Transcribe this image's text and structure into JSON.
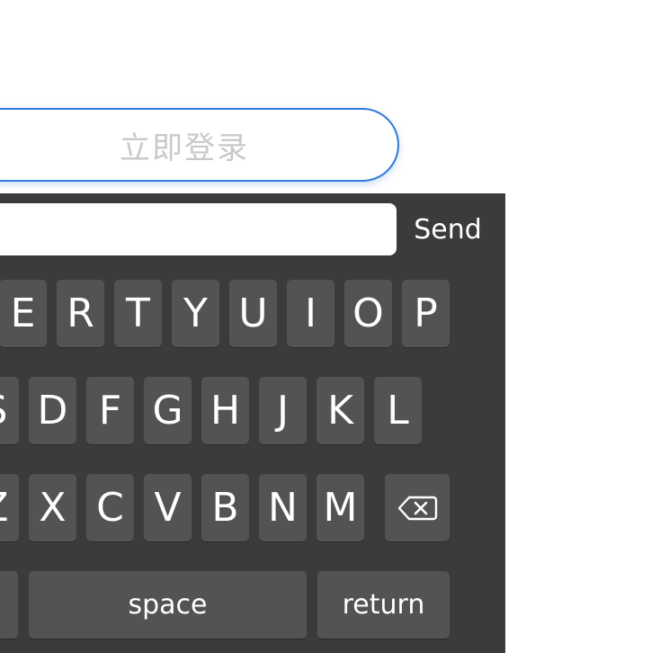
{
  "login": {
    "label": "立即登录"
  },
  "input_bar": {
    "value": "",
    "send_label": "Send"
  },
  "keyboard": {
    "row1": [
      "E",
      "R",
      "T",
      "Y",
      "U",
      "I",
      "O",
      "P"
    ],
    "row2": [
      "S",
      "D",
      "F",
      "G",
      "H",
      "J",
      "K",
      "L"
    ],
    "row3": [
      "Z",
      "X",
      "C",
      "V",
      "B",
      "N",
      "M"
    ],
    "space_label": "space",
    "return_label": "return",
    "delete_icon": "backspace-icon"
  },
  "colors": {
    "accent": "#2f7bd6",
    "keyboard_bg": "#3b3b3b",
    "key_bg": "#535353",
    "placeholder_text": "#c9c9c9"
  }
}
